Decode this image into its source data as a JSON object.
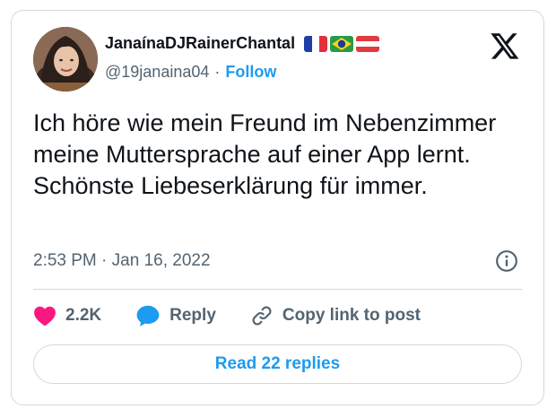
{
  "author": {
    "display_name": "JanaínaDJRainerChantal",
    "handle": "@19janaina04",
    "separator": "·",
    "follow_label": "Follow",
    "flags": [
      "france-flag",
      "brazil-flag",
      "austria-flag"
    ]
  },
  "tweet": {
    "text": "Ich höre wie mein Freund im Nebenzimmer meine Muttersprache auf einer App lernt. Schönste Liebeserklärung für immer.",
    "time": "2:53 PM",
    "meta_separator": "·",
    "date": "Jan 16, 2022"
  },
  "actions": {
    "likes_count": "2.2K",
    "reply_label": "Reply",
    "copy_link_label": "Copy link to post"
  },
  "replies_button": {
    "label": "Read 22 replies"
  },
  "colors": {
    "accent": "#1d9bf0",
    "like": "#f91880",
    "secondary_text": "#536471",
    "border": "#cfd9de"
  }
}
